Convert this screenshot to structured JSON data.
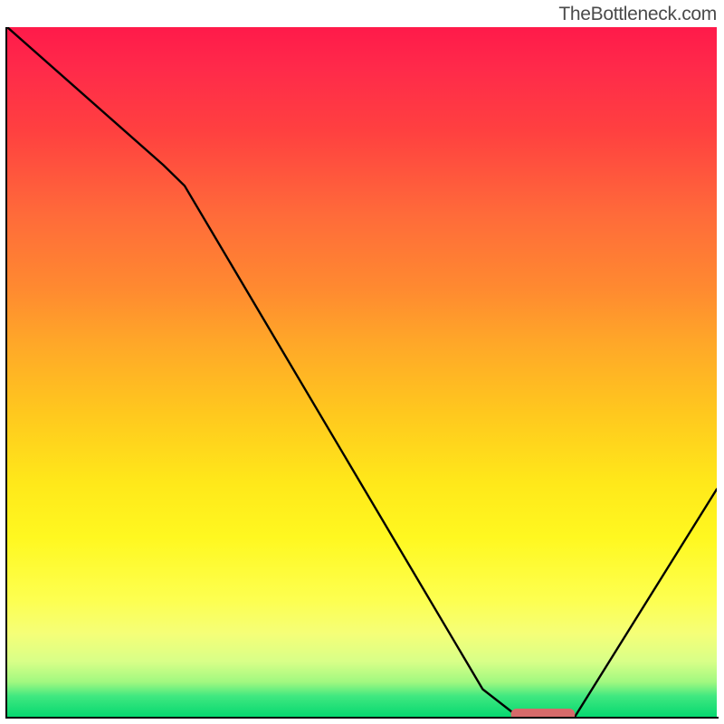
{
  "watermark": "TheBottleneck.com",
  "chart_data": {
    "type": "line",
    "title": "",
    "xlabel": "",
    "ylabel": "",
    "xlim": [
      0,
      100
    ],
    "ylim": [
      0,
      100
    ],
    "grid": false,
    "series": [
      {
        "name": "bottleneck-curve",
        "x": [
          0,
          22,
          25,
          67,
          72,
          80,
          100
        ],
        "values": [
          100,
          80,
          77,
          4,
          0,
          0,
          33
        ]
      }
    ],
    "marker": {
      "name": "optimal-range",
      "x_start": 71,
      "x_end": 80,
      "y": 0,
      "color": "#d66a6a"
    },
    "gradient_stops": [
      {
        "pos": 0,
        "color": "#ff1a4a"
      },
      {
        "pos": 15,
        "color": "#ff4040"
      },
      {
        "pos": 38,
        "color": "#ff8a30"
      },
      {
        "pos": 56,
        "color": "#ffc81e"
      },
      {
        "pos": 74,
        "color": "#fff820"
      },
      {
        "pos": 88,
        "color": "#f5ff78"
      },
      {
        "pos": 97,
        "color": "#40e880"
      },
      {
        "pos": 100,
        "color": "#06d870"
      }
    ]
  }
}
